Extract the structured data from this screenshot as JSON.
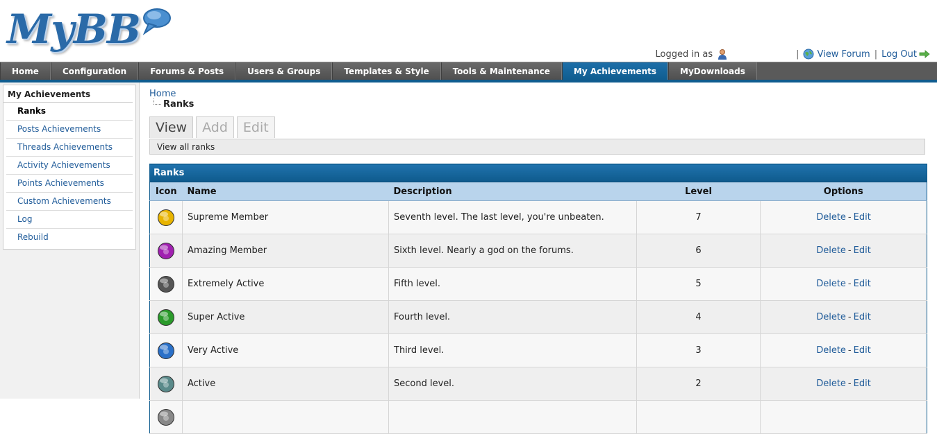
{
  "app": {
    "logo_text": "MyBB"
  },
  "userbar": {
    "logged_in_label": "Logged in as",
    "view_forum": "View Forum",
    "log_out": "Log Out",
    "separator": "|"
  },
  "nav": {
    "tabs": [
      {
        "label": "Home"
      },
      {
        "label": "Configuration"
      },
      {
        "label": "Forums & Posts"
      },
      {
        "label": "Users & Groups"
      },
      {
        "label": "Templates & Style"
      },
      {
        "label": "Tools & Maintenance"
      },
      {
        "label": "My Achievements",
        "active": true
      },
      {
        "label": "MyDownloads"
      }
    ]
  },
  "sidebar": {
    "title": "My Achievements",
    "items": [
      {
        "label": "Ranks",
        "active": true
      },
      {
        "label": "Posts Achievements"
      },
      {
        "label": "Threads Achievements"
      },
      {
        "label": "Activity Achievements"
      },
      {
        "label": "Points Achievements"
      },
      {
        "label": "Custom Achievements"
      },
      {
        "label": "Log"
      },
      {
        "label": "Rebuild"
      }
    ]
  },
  "breadcrumb": {
    "home": "Home",
    "current": "Ranks"
  },
  "subtabs": [
    {
      "label": "View",
      "active": true
    },
    {
      "label": "Add"
    },
    {
      "label": "Edit"
    }
  ],
  "tab_description": "View all ranks",
  "table": {
    "title": "Ranks",
    "columns": {
      "icon": "Icon",
      "name": "Name",
      "description": "Description",
      "level": "Level",
      "options": "Options"
    },
    "delete_label": "Delete",
    "edit_label": "Edit",
    "option_separator": "-",
    "rows": [
      {
        "icon": "sun-rank-icon",
        "icon_color": "#e8b400",
        "name": "Supreme Member",
        "description": "Seventh level. The last level, you're unbeaten.",
        "level": "7"
      },
      {
        "icon": "moon-rank-icon",
        "icon_color": "#a020b0",
        "name": "Amazing Member",
        "description": "Sixth level. Nearly a god on the forums.",
        "level": "6"
      },
      {
        "icon": "skull-rank-icon",
        "icon_color": "#555555",
        "name": "Extremely Active",
        "description": "Fifth level.",
        "level": "5"
      },
      {
        "icon": "tree-rank-icon",
        "icon_color": "#2a9a2a",
        "name": "Super Active",
        "description": "Fourth level.",
        "level": "4"
      },
      {
        "icon": "swirl-rank-icon",
        "icon_color": "#2a70c8",
        "name": "Very Active",
        "description": "Third level.",
        "level": "3"
      },
      {
        "icon": "chart-rank-icon",
        "icon_color": "#5a8a8a",
        "name": "Active",
        "description": "Second level.",
        "level": "2"
      },
      {
        "icon": "rank-icon",
        "icon_color": "#888888",
        "name": "",
        "description": "",
        "level": ""
      }
    ]
  }
}
